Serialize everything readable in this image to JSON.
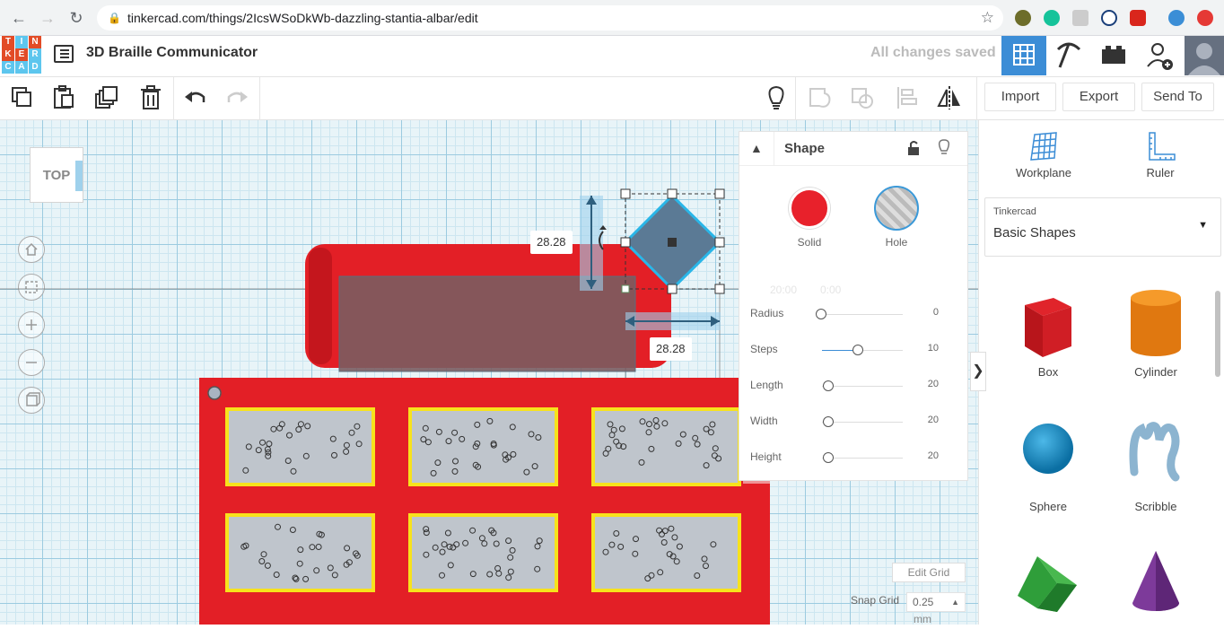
{
  "browser": {
    "url": "tinkercad.com/things/2IcsWSoDkWb-dazzling-stantia-albar/edit"
  },
  "app": {
    "logo_letters": [
      "T",
      "I",
      "N",
      "K",
      "E",
      "R",
      "C",
      "A",
      "D"
    ],
    "title": "3D Braille Communicator",
    "save_status": "All changes saved"
  },
  "toolbar": {
    "import": "Import",
    "export": "Export",
    "send_to": "Send To"
  },
  "viewcube": {
    "face": "TOP"
  },
  "inspector": {
    "title": "Shape",
    "solid_label": "Solid",
    "hole_label": "Hole",
    "ghost_values": [
      "20:00",
      "0:00"
    ],
    "params": [
      {
        "label": "Radius",
        "value": "0"
      },
      {
        "label": "Steps",
        "value": "10"
      },
      {
        "label": "Length",
        "value": "20"
      },
      {
        "label": "Width",
        "value": "20"
      },
      {
        "label": "Height",
        "value": "20"
      }
    ]
  },
  "dimensions": {
    "width": "28.28",
    "length": "28.28"
  },
  "grid": {
    "edit_grid": "Edit Grid",
    "snap_label": "Snap Grid",
    "snap_value": "0.25",
    "snap_unit": "mm"
  },
  "panel": {
    "workplane": "Workplane",
    "ruler": "Ruler",
    "library_caption": "Tinkercad",
    "library_value": "Basic Shapes",
    "shapes": [
      "Box",
      "Cylinder",
      "Sphere",
      "Scribble"
    ]
  },
  "colors": {
    "accent_blue": "#2d7fc1",
    "solid_red": "#e8212b",
    "braille_tray_red": "#e31f26",
    "label_yellow": "#f7e21c"
  }
}
